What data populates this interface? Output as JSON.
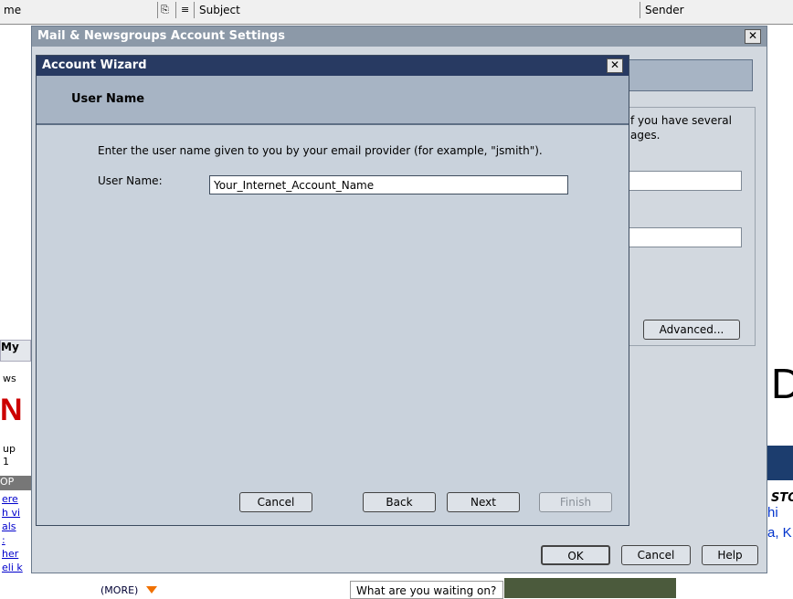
{
  "bg": {
    "header": {
      "col1": "me",
      "col_subject": "Subject",
      "col_sender": "Sender"
    },
    "left": {
      "tab_my": "My",
      "tab_ws": "ws",
      "brand": "N",
      "t_up": "up",
      "t_1": "1",
      "bar_op": "OP",
      "links": [
        "ere",
        "h vi",
        "als",
        ":",
        "her",
        "eli k"
      ]
    },
    "bottom": {
      "more": "(MORE)",
      "cell": "What are you waiting on?"
    },
    "right": {
      "letter": "D",
      "sto": "STO",
      "line1": "hi",
      "line2": "a, K"
    }
  },
  "outer": {
    "title": "Mail & Newsgroups Account Settings",
    "close": "✕",
    "frag1": "f you have several",
    "frag2": "ages.",
    "advanced": "Advanced...",
    "ok": "OK",
    "cancel": "Cancel",
    "help": "Help"
  },
  "wizard": {
    "title": "Account Wizard",
    "close": "✕",
    "page_title": "User Name",
    "description": "Enter the user name given to you by your email provider (for example, \"jsmith\").",
    "user_label": "User Name:",
    "user_value": "Your_Internet_Account_Name",
    "buttons": {
      "cancel": "Cancel",
      "back": "Back",
      "next": "Next",
      "finish": "Finish"
    }
  }
}
